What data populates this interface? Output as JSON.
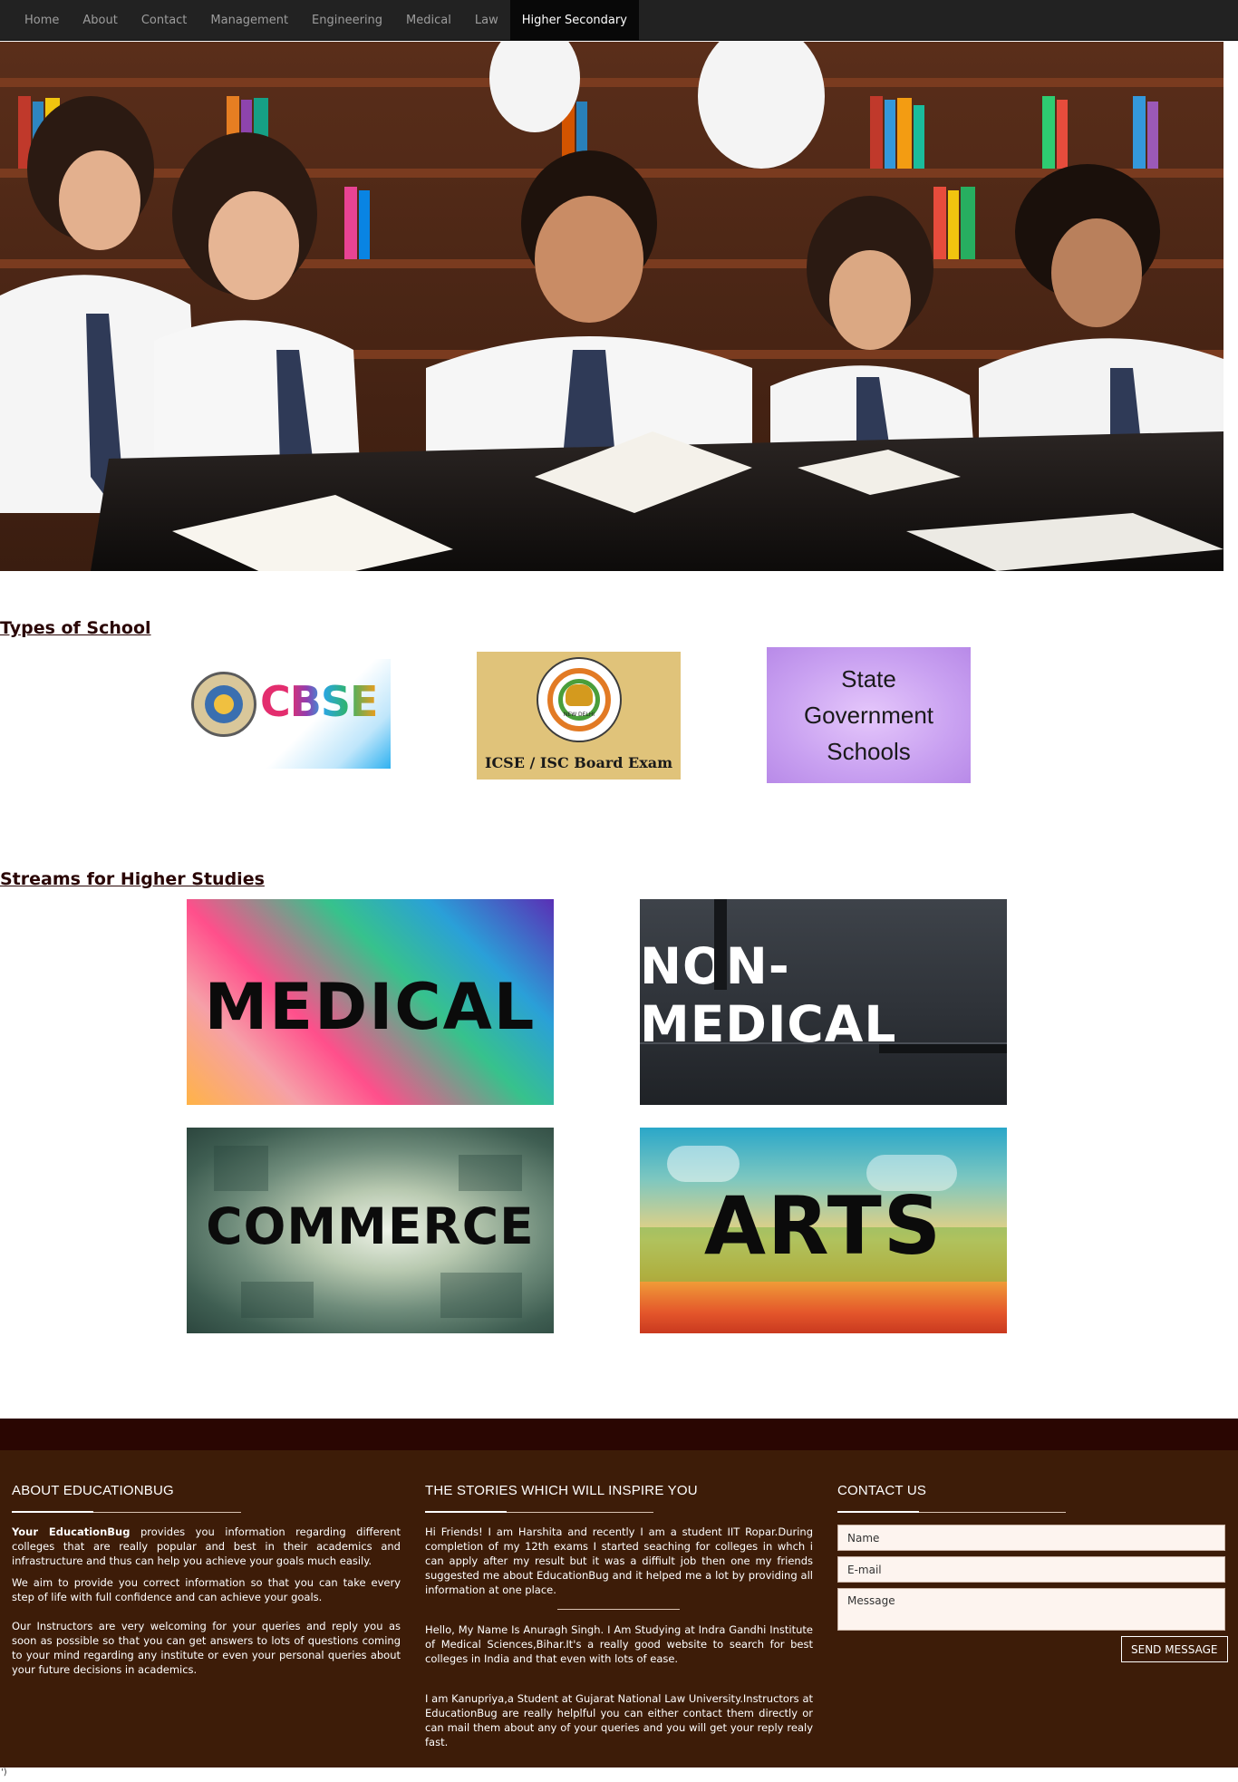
{
  "nav": {
    "items": [
      "Home",
      "About",
      "Contact",
      "Management",
      "Engineering",
      "Medical",
      "Law",
      "Higher Secondary"
    ],
    "active": "Higher Secondary"
  },
  "sections": {
    "types_of_school": "Types of School",
    "streams": "Streams for Higher Studies"
  },
  "schools": {
    "cbse": "CBSE",
    "icse": "ICSE / ISC Board Exam",
    "icse_seal": "NEW DELHI",
    "state_line1": "State",
    "state_line2": "Government",
    "state_line3": "Schools"
  },
  "streams": {
    "medical": "MEDICAL",
    "non_medical": "NON-MEDICAL",
    "commerce": "COMMERCE",
    "arts": "ARTS"
  },
  "footer": {
    "about_title": "ABOUT EDUCATIONBUG",
    "about_brand": "Your EducationBug",
    "about_p1_rest": " provides you information regarding different colleges that are really popular and best in their academics and infrastructure and thus can help you achieve your goals much easily.",
    "about_p2": "We aim to provide you correct information so that you can take every step of life with full confidence and can achieve your goals.",
    "about_p3": "Our Instructors are very welcoming for your queries and reply you as soon as possible so that you can get answers to lots of questions coming to your mind regarding any institute or even your personal queries about your future decisions in academics.",
    "stories_title": "THE STORIES WHICH WILL INSPIRE YOU",
    "story1": "Hi Friends! I am Harshita and recently I am a student IIT Ropar.During completion of my 12th exams I started seaching for colleges in whch i can apply after my result but it was a diffiult job then one my friends suggested me about EducationBug and it helped me a lot by providing all information at one place.",
    "story2": "Hello, My Name Is Anuragh Singh. I Am Studying at Indra Gandhi Institute of Medical Sciences,Bihar.It's a really good website to search for best colleges in India and that even with lots of ease.",
    "story3": "I am Kanupriya,a Student at Gujarat National Law University.Instructors at EducationBug are really helplful you can either contact them directly or can mail them about any of your queries and you will get your reply realy fast.",
    "contact_title": "CONTACT US",
    "name_placeholder": "Name",
    "email_placeholder": "E-mail",
    "message_placeholder": "Message",
    "send_label": "SEND MESSAGE"
  },
  "stray_text": "')",
  "colors": {
    "nav_bg": "#222222",
    "heading": "#2a0606",
    "footer_bg": "#3d1c08",
    "footer_band": "#2a0602"
  }
}
